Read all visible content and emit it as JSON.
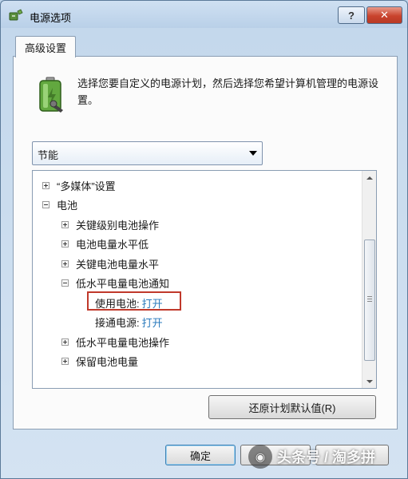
{
  "window": {
    "title": "电源选项",
    "help_label": "?",
    "close_label": "✕"
  },
  "tab": {
    "label": "高级设置"
  },
  "description": "选择您要自定义的电源计划，然后选择您希望计算机管理的电源设置。",
  "plan_select": {
    "value": "节能"
  },
  "tree": [
    {
      "label": "“多媒体”设置",
      "expander": "plus"
    },
    {
      "label": "电池",
      "expander": "minus"
    },
    {
      "label": "关键级别电池操作",
      "expander": "plus"
    },
    {
      "label": "电池电量水平低",
      "expander": "plus"
    },
    {
      "label": "关键电池电量水平",
      "expander": "plus"
    },
    {
      "label": "低水平电量电池通知",
      "expander": "minus"
    },
    {
      "label": "使用电池:",
      "value": "打开"
    },
    {
      "label": "接通电源:",
      "value": "打开"
    },
    {
      "label": "低水平电量电池操作",
      "expander": "plus"
    },
    {
      "label": "保留电池电量",
      "expander": "plus"
    }
  ],
  "buttons": {
    "restore": "还原计划默认值(R)",
    "ok": "确定",
    "cancel": "",
    "apply": ""
  },
  "watermark": {
    "text": "头条号 / 淘多拼"
  },
  "colors": {
    "value_link": "#2b7bbd",
    "highlight_box": "#c0392b",
    "close_button": "#c9432d"
  }
}
